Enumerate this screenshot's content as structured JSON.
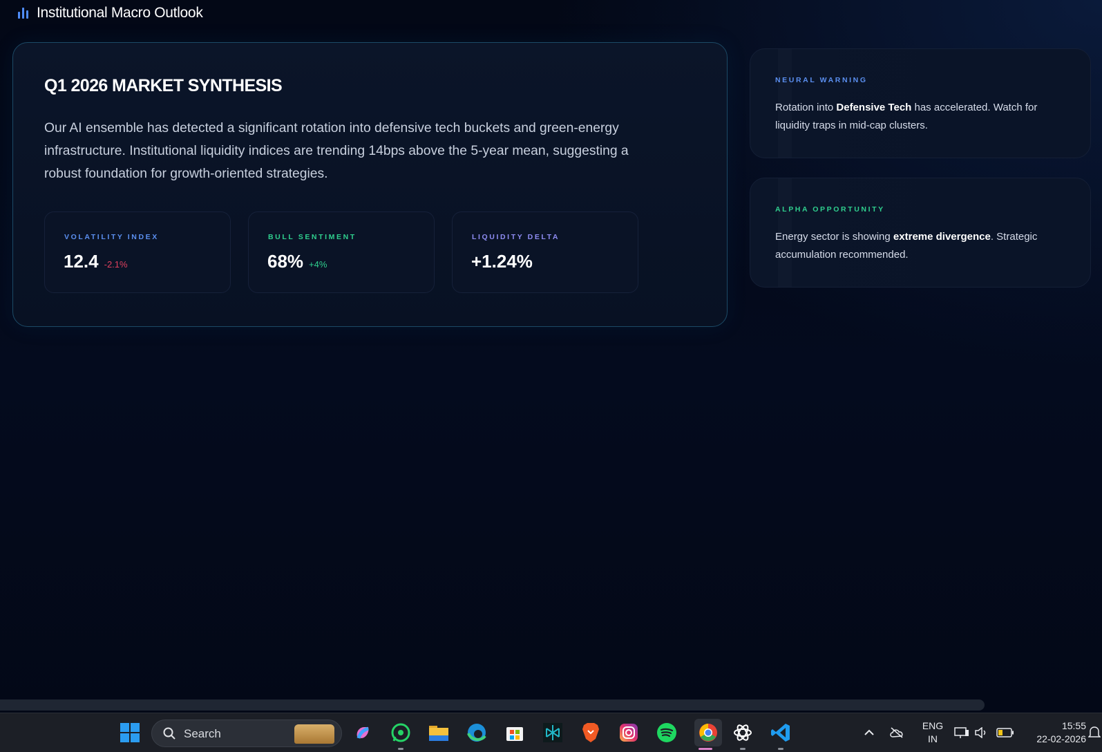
{
  "header": {
    "title": "Institutional Macro Outlook"
  },
  "synthesis": {
    "heading": "Q1 2026 MARKET SYNTHESIS",
    "body": "Our AI ensemble has detected a significant rotation into defensive tech buckets and green-energy infrastructure. Institutional liquidity indices are trending 14bps above the 5-year mean, suggesting a robust foundation for growth-oriented strategies.",
    "metrics": [
      {
        "label": "VOLATILITY INDEX",
        "value": "12.4",
        "delta": "-2.1%",
        "label_color": "#5b8ff0",
        "delta_color": "#e0405e"
      },
      {
        "label": "BULL SENTIMENT",
        "value": "68%",
        "delta": "+4%",
        "label_color": "#2fcf8e",
        "delta_color": "#2fcf8e"
      },
      {
        "label": "LIQUIDITY DELTA",
        "value": "+1.24%",
        "delta": "",
        "label_color": "#8e8cf2",
        "delta_color": "#8e8cf2"
      }
    ]
  },
  "alerts": [
    {
      "label": "NEURAL WARNING",
      "label_color": "#5b8ff0",
      "text_before": "Rotation into ",
      "text_bold": "Defensive Tech",
      "text_after": " has accelerated. Watch for liquidity traps in mid-cap clusters."
    },
    {
      "label": "ALPHA OPPORTUNITY",
      "label_color": "#2fcf8e",
      "text_before": "Energy sector is showing ",
      "text_bold": "extreme divergence",
      "text_after": ". Strategic accumulation recommended."
    }
  ],
  "taskbar": {
    "search_placeholder": "Search",
    "language_line1": "ENG",
    "language_line2": "IN",
    "time": "15:55",
    "date": "22-02-2026",
    "apps": [
      "copilot-icon",
      "whatsapp-icon",
      "file-explorer-icon",
      "edge-icon",
      "store-icon",
      "perplexity-icon",
      "brave-icon",
      "instagram-icon",
      "spotify-icon",
      "chrome-icon",
      "chatgpt-icon",
      "vscode-icon"
    ]
  }
}
